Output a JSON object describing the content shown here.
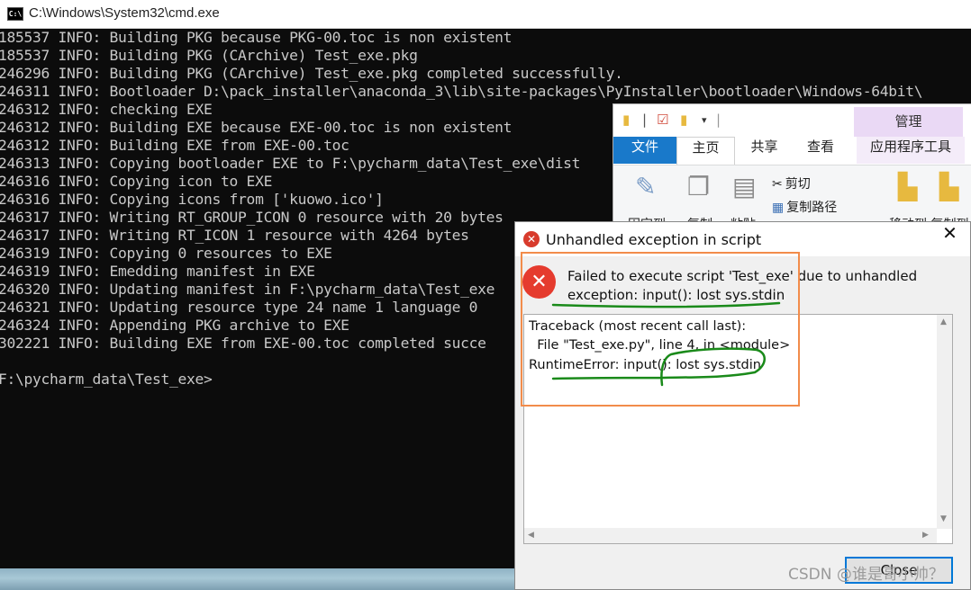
{
  "cmd": {
    "title": "C:\\Windows\\System32\\cmd.exe",
    "icon_label": "C:\\",
    "lines": [
      "185537 INFO: Building PKG because PKG-00.toc is non existent",
      "185537 INFO: Building PKG (CArchive) Test_exe.pkg",
      "246296 INFO: Building PKG (CArchive) Test_exe.pkg completed successfully.",
      "246311 INFO: Bootloader D:\\pack_installer\\anaconda_3\\lib\\site-packages\\PyInstaller\\bootloader\\Windows-64bit\\",
      "246312 INFO: checking EXE",
      "246312 INFO: Building EXE because EXE-00.toc is non existent",
      "246312 INFO: Building EXE from EXE-00.toc",
      "246313 INFO: Copying bootloader EXE to F:\\pycharm_data\\Test_exe\\dist",
      "246316 INFO: Copying icon to EXE",
      "246316 INFO: Copying icons from ['kuowo.ico']",
      "246317 INFO: Writing RT_GROUP_ICON 0 resource with 20 bytes",
      "246317 INFO: Writing RT_ICON 1 resource with 4264 bytes",
      "246319 INFO: Copying 0 resources to EXE",
      "246319 INFO: Emedding manifest in EXE",
      "246320 INFO: Updating manifest in F:\\pycharm_data\\Test_exe",
      "246321 INFO: Updating resource type 24 name 1 language 0",
      "246324 INFO: Appending PKG archive to EXE",
      "302221 INFO: Building EXE from EXE-00.toc completed succe",
      "",
      "F:\\pycharm_data\\Test_exe>"
    ]
  },
  "explorer": {
    "manage_tab": "管理",
    "tabs": {
      "file": "文件",
      "home": "主页",
      "share": "共享",
      "view": "查看",
      "app_tools": "应用程序工具"
    },
    "ribbon": {
      "pin": "固定到",
      "copy": "复制",
      "paste": "粘贴",
      "cut": "剪切",
      "copy_path": "复制路径",
      "move_copy": "移动到 复制到"
    }
  },
  "dialog": {
    "title": "Unhandled exception in script",
    "message_line1": "Failed to execute script 'Test_exe' due to unhandled",
    "message_line2": "exception: input(): lost sys.stdin",
    "traceback": [
      "Traceback (most recent call last):",
      "  File \"Test_exe.py\", line 4, in <module>",
      "RuntimeError: input(): lost sys.stdin"
    ],
    "close_label": "Close"
  },
  "watermark": "CSDN @谁是哥小帅？",
  "colors": {
    "console_bg": "#0c0c0c",
    "console_text": "#c8c8c8",
    "file_tab": "#1979ca",
    "manage_tab": "#ead9f5",
    "annotation_box": "#f28c4b",
    "annotation_underline": "#1a8a1a",
    "error_red": "#e53b2e"
  }
}
